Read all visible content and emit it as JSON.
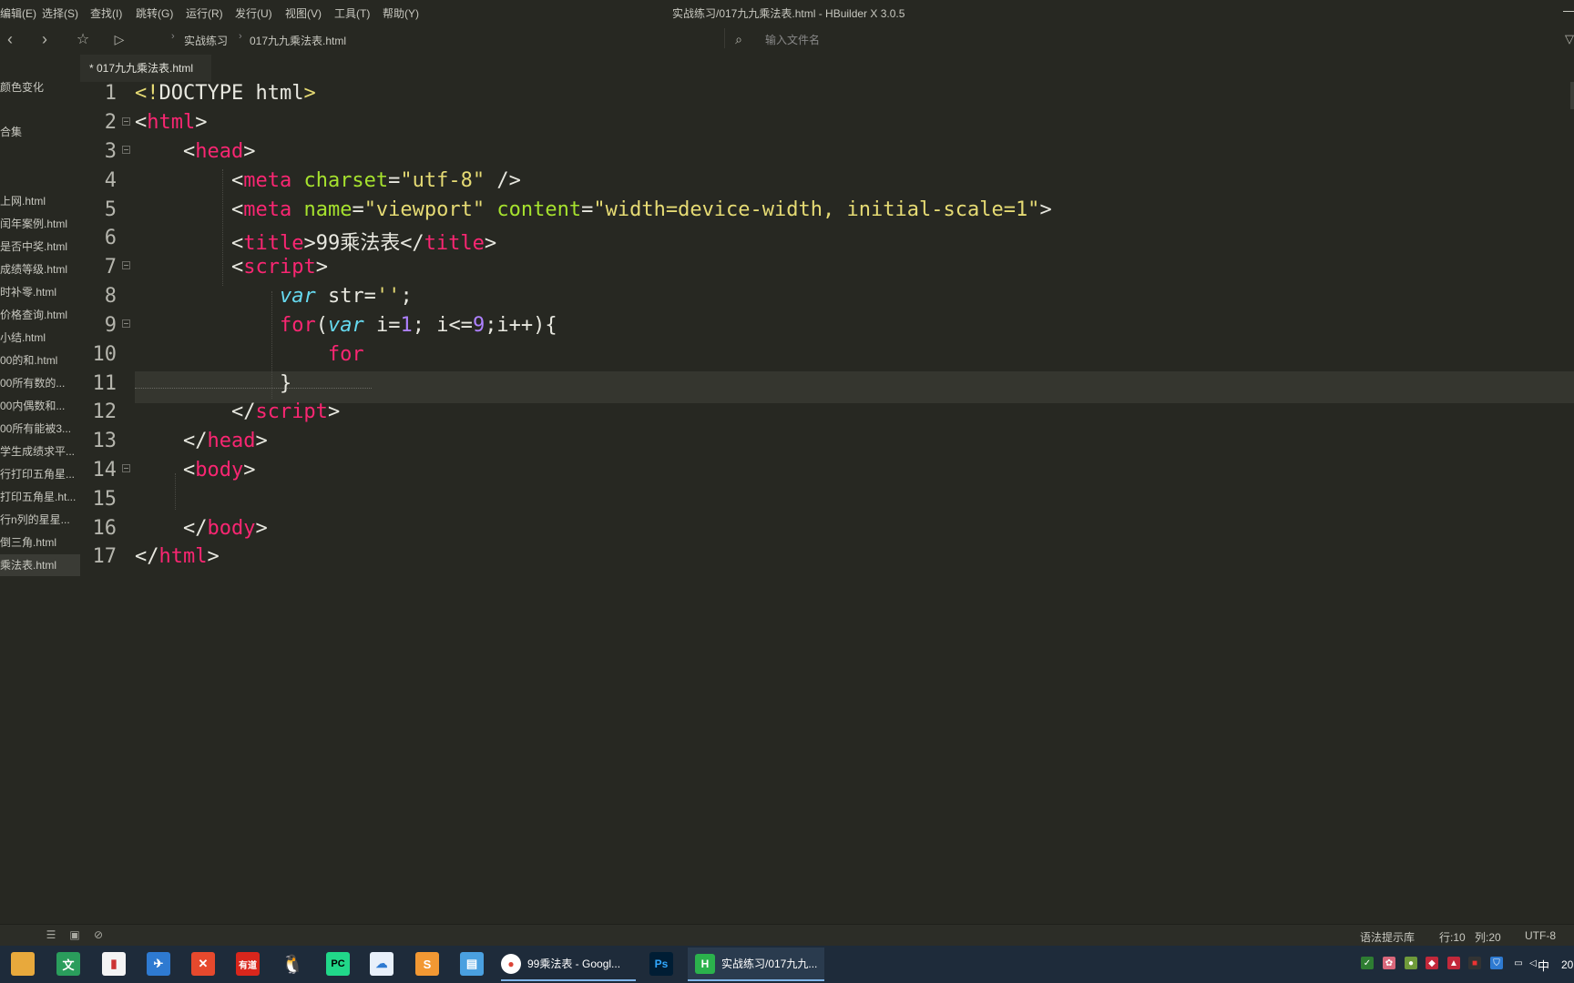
{
  "menu": [
    "编辑(E)",
    "选择(S)",
    "查找(I)",
    "跳转(G)",
    "运行(R)",
    "发行(U)",
    "视图(V)",
    "工具(T)",
    "帮助(Y)"
  ],
  "window_title": "实战练习/017九九乘法表.html - HBuilder X 3.0.5",
  "toolbar": {
    "breadcrumb": [
      "实战练习",
      "017九九乘法表.html"
    ],
    "search_placeholder": "输入文件名"
  },
  "sidebar": {
    "items": [
      "颜色变化",
      "合集",
      "上网.html",
      "闰年案例.html",
      "是否中奖.html",
      "成绩等级.html",
      "时补零.html",
      "价格查询.html",
      "小结.html",
      "00的和.html",
      "00所有数的...",
      "00内偶数和...",
      "00所有能被3...",
      "学生成绩求平...",
      "行打印五角星...",
      "打印五角星.ht...",
      "行n列的星星...",
      "倒三角.html",
      "乘法表.html"
    ],
    "active_index": 18
  },
  "tab": {
    "label": "* 017九九乘法表.html"
  },
  "editor": {
    "line_numbers": [
      "1",
      "2",
      "3",
      "4",
      "5",
      "6",
      "7",
      "8",
      "9",
      "10",
      "11",
      "12",
      "13",
      "14",
      "15",
      "16",
      "17"
    ]
  },
  "status": {
    "syntax_hint": "语法提示库",
    "cursor_line": "行:10",
    "cursor_col": "列:20",
    "encoding": "UTF-8"
  },
  "taskbar": {
    "chrome_task": "99乘法表 - Googl...",
    "hbuilder_task": "实战练习/017九九...",
    "ime": "中",
    "clock": "20"
  },
  "colors": {
    "editor_bg": "#272822",
    "tag": "#f92672",
    "attribute": "#a6e22e",
    "string": "#e6db74",
    "keyword": "#66d9ef",
    "number": "#ae81ff"
  }
}
